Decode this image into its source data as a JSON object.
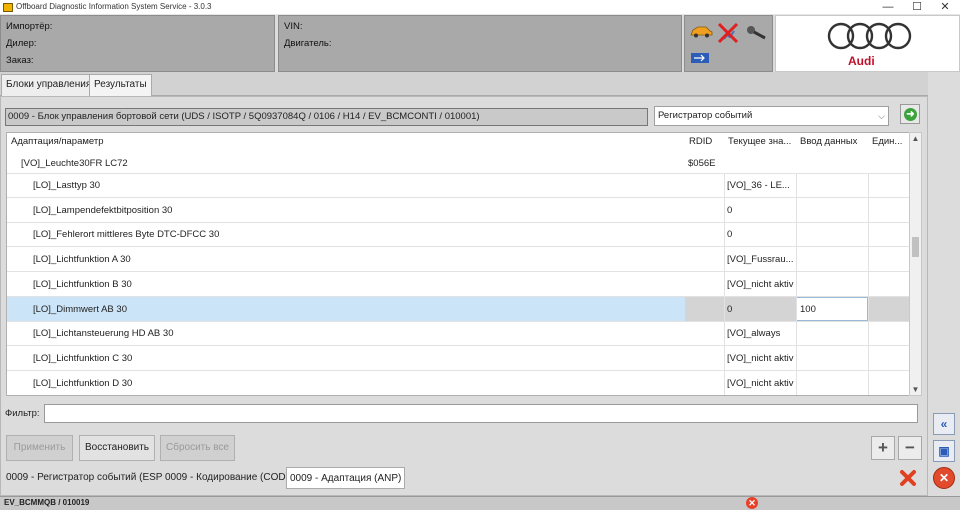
{
  "window": {
    "title": "Offboard Diagnostic Information System Service - 3.0.3",
    "minimize": "—",
    "maximize": "☐",
    "close": "✕"
  },
  "info": {
    "importer_label": "Импортёр:",
    "dealer_label": "Дилер:",
    "order_label": "Заказ:",
    "vin_label": "VIN:",
    "engine_label": "Двигатель:",
    "brand": "Audi"
  },
  "tabs": [
    {
      "label": "Блоки управления"
    },
    {
      "label": "Результаты"
    }
  ],
  "ecu": {
    "description": "0009 - Блок управления бортовой сети  (UDS / ISOTP / 5Q0937084Q  / 0106 / H14 / EV_BCMCONTI / 010001)",
    "mode_selected": "Регистратор событий"
  },
  "table": {
    "headers": {
      "param": "Адаптация/параметр",
      "rdid": "RDID",
      "current": "Текущее зна...",
      "input": "Ввод данных",
      "unit": "Един..."
    },
    "rows": [
      {
        "param": "[VO]_Leuchte30FR LC72",
        "rdid": "$056E",
        "current": "",
        "input": "",
        "unit": ""
      },
      {
        "param": "[LO]_Lasttyp 30",
        "rdid": "",
        "current": "[VO]_36 - LE...",
        "input": "",
        "unit": ""
      },
      {
        "param": "[LO]_Lampendefektbitposition 30",
        "rdid": "",
        "current": "0",
        "input": "",
        "unit": ""
      },
      {
        "param": "[LO]_Fehlerort mittleres Byte DTC-DFCC 30",
        "rdid": "",
        "current": "0",
        "input": "",
        "unit": ""
      },
      {
        "param": "[LO]_Lichtfunktion A 30",
        "rdid": "",
        "current": "[VO]_Fussrau...",
        "input": "",
        "unit": ""
      },
      {
        "param": "[LO]_Lichtfunktion B 30",
        "rdid": "",
        "current": "[VO]_nicht aktiv",
        "input": "",
        "unit": ""
      },
      {
        "param": "[LO]_Dimmwert AB 30",
        "rdid": "",
        "current": "0",
        "input": "100",
        "unit": ""
      },
      {
        "param": "[LO]_Lichtansteuerung HD AB 30",
        "rdid": "",
        "current": "[VO]_always",
        "input": "",
        "unit": ""
      },
      {
        "param": "[LO]_Lichtfunktion C 30",
        "rdid": "",
        "current": "[VO]_nicht aktiv",
        "input": "",
        "unit": ""
      },
      {
        "param": "[LO]_Lichtfunktion D 30",
        "rdid": "",
        "current": "[VO]_nicht aktiv",
        "input": "",
        "unit": ""
      }
    ]
  },
  "filter": {
    "label": "Фильтр:",
    "value": ""
  },
  "buttons": {
    "apply": "Применить",
    "restore": "Восстановить",
    "reset_all": "Сбросить все",
    "add": "+",
    "remove": "−"
  },
  "bottom_tabs": [
    {
      "label": "0009 - Регистратор событий (ESP)"
    },
    {
      "label": "0009 - Кодирование (COD)"
    },
    {
      "label": "0009 - Адаптация (ANP)"
    }
  ],
  "status": {
    "text": "EV_BCMMQB / 010019"
  },
  "colors": {
    "selected_row": "#cce4f7",
    "header_gray": "#a9a9a9",
    "audi_red": "#c0102a"
  }
}
